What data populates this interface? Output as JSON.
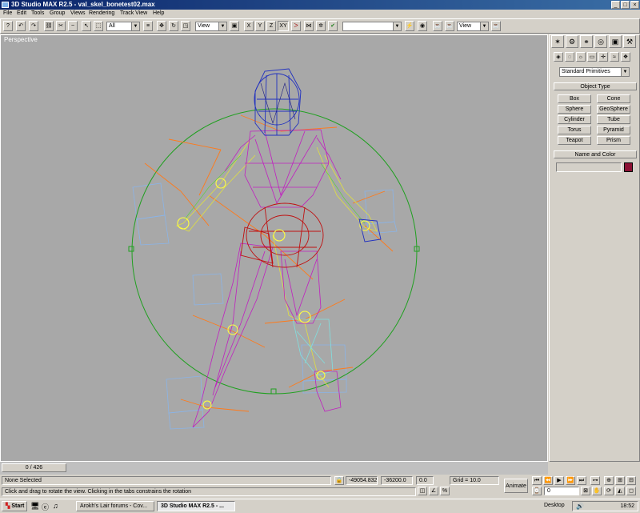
{
  "window": {
    "title": "3D Studio MAX R2.5 - val_skel_bonetest02.max"
  },
  "menu": [
    "File",
    "Edit",
    "Tools",
    "Group",
    "Views",
    "Rendering",
    "Track View",
    "Help"
  ],
  "toolbar": {
    "selection_filter": "All",
    "ref_coord_1": "View",
    "ref_coord_2": "View",
    "axis_x": "X",
    "axis_y": "Y",
    "axis_z": "Z",
    "axis_xy": "XY",
    "named_selection": ""
  },
  "viewport": {
    "label": "Perspective"
  },
  "command_panel": {
    "category": "Standard Primitives",
    "object_type_header": "Object Type",
    "buttons": [
      "Box",
      "Cone",
      "Sphere",
      "GeoSphere",
      "Cylinder",
      "Tube",
      "Torus",
      "Pyramid",
      "Teapot",
      "Prism"
    ],
    "name_color_header": "Name and Color",
    "name_value": "",
    "object_color": "#8b1034"
  },
  "time": {
    "slider": "0 / 426",
    "current_frame": "0"
  },
  "status": {
    "selection": "None Selected",
    "prompt": "Click and drag to rotate the view.  Clicking in the tabs constrains the rotation",
    "coord_x": "-49054.832",
    "coord_y": "-36200.0",
    "coord_z": "0.0",
    "grid": "Grid = 10.0",
    "animate_label": "Animate"
  },
  "taskbar": {
    "start": "Start",
    "tasks": [
      "Arokh's Lair forums - Cov...",
      "3D Studio MAX R2.5 - ..."
    ],
    "desktop": "Desktop",
    "clock": "18:52"
  }
}
